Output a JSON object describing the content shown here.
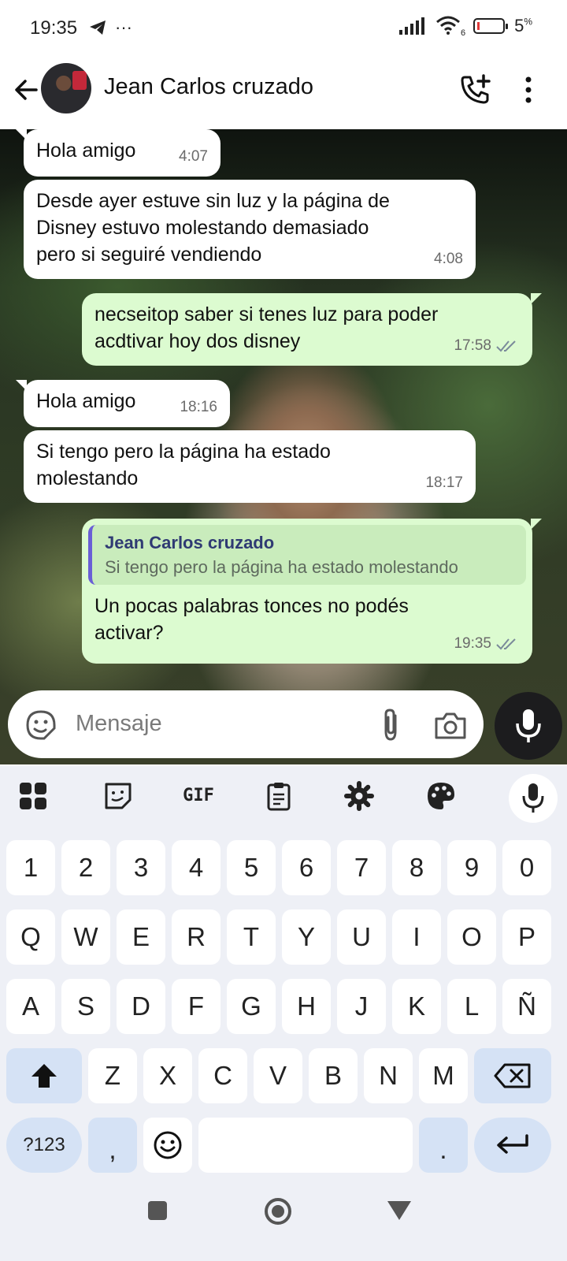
{
  "status_bar": {
    "time": "19:35",
    "overflow": "···",
    "battery_pct": "5",
    "battery_unit": "%",
    "wifi_badge": "6",
    "icons": [
      "telegram-icon",
      "signal-icon",
      "wifi-icon",
      "battery-icon"
    ]
  },
  "header": {
    "contact_name": "Jean Carlos cruzado",
    "icons": [
      "back-arrow-icon",
      "add-call-icon",
      "more-vert-icon"
    ]
  },
  "messages": [
    {
      "dir": "in",
      "text": "Hola amigo",
      "time": "4:07"
    },
    {
      "dir": "in",
      "text": "Desde ayer estuve sin luz y la página de\nDisney estuvo molestando demasiado\npero si seguiré vendiendo",
      "time": "4:08"
    },
    {
      "dir": "out",
      "text": "necseitop saber si tenes luz para poder\nacdtivar hoy dos disney",
      "time": "17:58",
      "read": true
    },
    {
      "dir": "in",
      "text": "Hola amigo",
      "time": "18:16"
    },
    {
      "dir": "in",
      "text": "Si tengo pero la página ha estado\nmolestando",
      "time": "18:17"
    },
    {
      "dir": "out",
      "quote_name": "Jean Carlos cruzado",
      "quote_text": "Si tengo pero la página ha estado molestando",
      "text": "Un pocas palabras tonces no podés\nactivar?",
      "time": "19:35",
      "read": true
    }
  ],
  "composer": {
    "placeholder": "Mensaje",
    "icons": [
      "sticker-emoji-icon",
      "attach-icon",
      "camera-icon",
      "mic-icon"
    ]
  },
  "keyboard": {
    "toolbar": [
      "apps-grid-icon",
      "sticker-icon",
      "GIF",
      "clipboard-icon",
      "settings-icon",
      "palette-icon",
      "mic-icon"
    ],
    "gif_label": "GIF",
    "row_numbers": [
      "1",
      "2",
      "3",
      "4",
      "5",
      "6",
      "7",
      "8",
      "9",
      "0"
    ],
    "row_1": [
      "Q",
      "W",
      "E",
      "R",
      "T",
      "Y",
      "U",
      "I",
      "O",
      "P"
    ],
    "row_2": [
      "A",
      "S",
      "D",
      "F",
      "G",
      "H",
      "J",
      "K",
      "L",
      "Ñ"
    ],
    "row_3": [
      "Z",
      "X",
      "C",
      "V",
      "B",
      "N",
      "M"
    ],
    "symbols_key": "?123",
    "comma_key": ",",
    "period_key": ".",
    "colors": {
      "key": "#ffffff",
      "function_key": "#d5e2f5",
      "background": "#eef0f6"
    }
  },
  "nav_bar": {
    "icons": [
      "recents-square-icon",
      "home-circle-icon",
      "back-triangle-icon"
    ]
  },
  "colors": {
    "outgoing_bubble": "#dcfbd0",
    "incoming_bubble": "#ffffff",
    "quote_bar": "#6a5fd6",
    "quote_name": "#2f3a73"
  }
}
